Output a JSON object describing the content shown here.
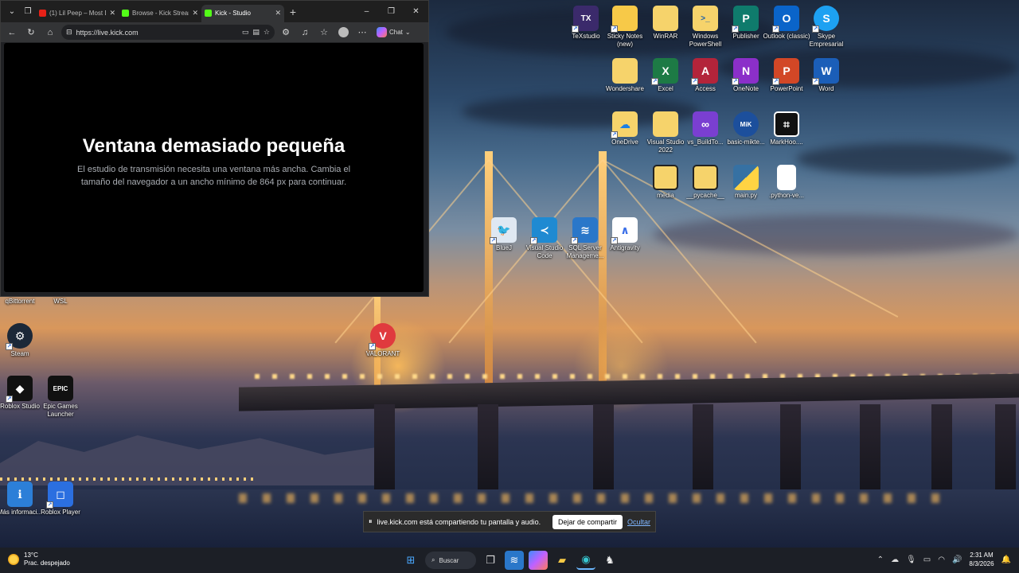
{
  "browser": {
    "tabs": [
      {
        "title": "(1) Lil Peep – Most D...",
        "favicon_color": "#e62117"
      },
      {
        "title": "Browse - Kick Stream",
        "favicon_color": "#53fc18"
      },
      {
        "title": "Kick - Studio",
        "favicon_color": "#53fc18"
      }
    ],
    "address": "https://live.kick.com",
    "chat_label": "Chat",
    "page": {
      "heading": "Ventana demasiado pequeña",
      "message": "El estudio de transmisión necesita una ventana más ancha. Cambia el tamaño del navegador a un ancho mínimo de 864 px para continuar."
    }
  },
  "desktop_icons": {
    "texstudio": "TeXstudio",
    "sticky": "Sticky Notes (new)",
    "winrar": "WinRAR",
    "powershell": "Windows PowerShell",
    "publisher": "Publisher",
    "outlook": "Outlook (classic)",
    "skype": "Skype Empresarial",
    "wondershare": "Wondershare",
    "excel": "Excel",
    "access": "Access",
    "onenote": "OneNote",
    "powerpoint": "PowerPoint",
    "word": "Word",
    "onedrive": "OneDrive",
    "vs2022": "Visual Studio 2022",
    "vsbuild": "vs_BuildTo...",
    "miktex": "basic-mikte...",
    "markhoo": "MarkHoo....",
    "media": "media",
    "pycache": "__pycache__",
    "mainpy": "main.py",
    "pythonver": ".python-ve...",
    "bluej": "BlueJ",
    "vscode": "Visual Studio Code",
    "ssms": "SQL Server Manageme...",
    "antigravity": "Antigravity",
    "qbittorrent": "qBittorrent",
    "wsl": "WSL",
    "steam": "Steam",
    "valorant": "VALORANT",
    "roblox_studio": "Roblox Studio",
    "epic": "Epic Games Launcher",
    "mas_info": "Más informaci...",
    "roblox_player": "Roblox Player"
  },
  "share_bar": {
    "message": "live.kick.com está compartiendo tu pantalla y audio.",
    "stop_label": "Dejar de compartir",
    "hide_label": "Ocultar"
  },
  "taskbar": {
    "weather_temp": "13°C",
    "weather_desc": "Prac. despejado",
    "search_label": "Buscar",
    "time": "2:31 AM",
    "date": "8/3/2026"
  }
}
